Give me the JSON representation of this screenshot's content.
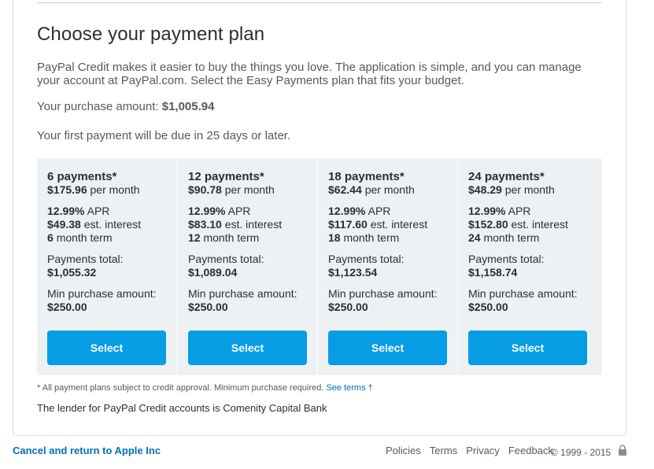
{
  "title": "Choose your payment plan",
  "intro": "PayPal Credit makes it easier to buy the things you love. The application is simple, and you can manage your account at PayPal.com. Select the Easy Payments plan that fits your budget.",
  "purchase": {
    "label": "Your purchase amount:",
    "amount": "$1,005.94"
  },
  "due": "Your first payment will be due in 25 days or later.",
  "plans": [
    {
      "payments": "6 payments*",
      "monthly": "$175.96",
      "per_month": "per month",
      "apr": "12.99%",
      "apr_label": "APR",
      "interest": "$49.38",
      "interest_label": "est. interest",
      "term": "6",
      "term_label": "month term",
      "total_label": "Payments total:",
      "total": "$1,055.32",
      "min_label": "Min purchase amount:",
      "min": "$250.00",
      "button": "Select"
    },
    {
      "payments": "12 payments*",
      "monthly": "$90.78",
      "per_month": "per month",
      "apr": "12.99%",
      "apr_label": "APR",
      "interest": "$83.10",
      "interest_label": "est. interest",
      "term": "12",
      "term_label": "month term",
      "total_label": "Payments total:",
      "total": "$1,089.04",
      "min_label": "Min purchase amount:",
      "min": "$250.00",
      "button": "Select"
    },
    {
      "payments": "18 payments*",
      "monthly": "$62.44",
      "per_month": "per month",
      "apr": "12.99%",
      "apr_label": "APR",
      "interest": "$117.60",
      "interest_label": "est. interest",
      "term": "18",
      "term_label": "month term",
      "total_label": "Payments total:",
      "total": "$1,123.54",
      "min_label": "Min purchase amount:",
      "min": "$250.00",
      "button": "Select"
    },
    {
      "payments": "24 payments*",
      "monthly": "$48.29",
      "per_month": "per month",
      "apr": "12.99%",
      "apr_label": "APR",
      "interest": "$152.80",
      "interest_label": "est. interest",
      "term": "24",
      "term_label": "month term",
      "total_label": "Payments total:",
      "total": "$1,158.74",
      "min_label": "Min purchase amount:",
      "min": "$250.00",
      "button": "Select"
    }
  ],
  "footnote": {
    "text": "* All payment plans subject to credit approval. Minimum purchase required.",
    "link": "See terms",
    "dagger": "†"
  },
  "lender": "The lender for PayPal Credit accounts is Comenity Capital Bank",
  "footer": {
    "cancel": "Cancel and return to Apple Inc",
    "links": [
      "Policies",
      "Terms",
      "Privacy",
      "Feedback"
    ],
    "copyright": "© 1999 - 2015",
    "lock_icon": "lock-icon"
  },
  "colors": {
    "button": "#069de4",
    "link": "#0070ba",
    "plans_bg": "#eef1f3"
  }
}
